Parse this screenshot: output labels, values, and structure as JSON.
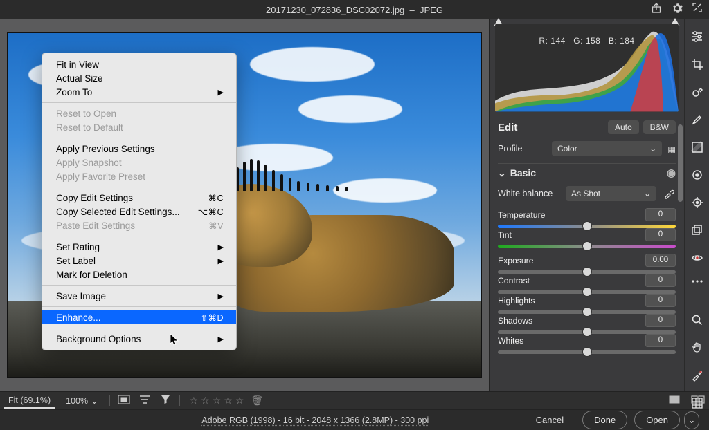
{
  "title": {
    "filename": "20171230_072836_DSC02072.jpg",
    "format": "JPEG"
  },
  "titlebar_icons": [
    "share-icon",
    "settings-icon",
    "fullscreen-icon"
  ],
  "context_menu": {
    "groups": [
      [
        {
          "label": "Fit in View",
          "arrow": false,
          "disabled": false
        },
        {
          "label": "Actual Size",
          "arrow": false,
          "disabled": false
        },
        {
          "label": "Zoom To",
          "arrow": true,
          "disabled": false
        }
      ],
      [
        {
          "label": "Reset to Open",
          "arrow": false,
          "disabled": true
        },
        {
          "label": "Reset to Default",
          "arrow": false,
          "disabled": true
        }
      ],
      [
        {
          "label": "Apply Previous Settings",
          "arrow": false,
          "disabled": false
        },
        {
          "label": "Apply Snapshot",
          "arrow": false,
          "disabled": true
        },
        {
          "label": "Apply Favorite Preset",
          "arrow": false,
          "disabled": true
        }
      ],
      [
        {
          "label": "Copy Edit Settings",
          "arrow": false,
          "shortcut": "⌘C",
          "disabled": false
        },
        {
          "label": "Copy Selected Edit Settings...",
          "arrow": false,
          "shortcut": "⌥⌘C",
          "disabled": false
        },
        {
          "label": "Paste Edit Settings",
          "arrow": false,
          "shortcut": "⌘V",
          "disabled": true
        }
      ],
      [
        {
          "label": "Set Rating",
          "arrow": true,
          "disabled": false
        },
        {
          "label": "Set Label",
          "arrow": true,
          "disabled": false
        },
        {
          "label": "Mark for Deletion",
          "arrow": false,
          "disabled": false
        }
      ],
      [
        {
          "label": "Save Image",
          "arrow": true,
          "disabled": false
        }
      ],
      [
        {
          "label": "Enhance...",
          "arrow": false,
          "shortcut_hl": "⇧⌘D",
          "highlight": true
        }
      ],
      [
        {
          "label": "Background Options",
          "arrow": true,
          "disabled": false
        }
      ]
    ]
  },
  "histogram": {
    "readout": {
      "R": 144,
      "G": 158,
      "B": 184
    }
  },
  "edit": {
    "title": "Edit",
    "buttons": {
      "auto": "Auto",
      "bw": "B&W"
    },
    "profile_label": "Profile",
    "profile_value": "Color",
    "basic_title": "Basic",
    "wb_label": "White balance",
    "wb_value": "As Shot",
    "sliders": [
      {
        "name": "Temperature",
        "value": "0",
        "variant": "temp",
        "pos": 50
      },
      {
        "name": "Tint",
        "value": "0",
        "variant": "tint",
        "pos": 50
      },
      null,
      {
        "name": "Exposure",
        "value": "0.00",
        "variant": "plain",
        "pos": 50
      },
      {
        "name": "Contrast",
        "value": "0",
        "variant": "plain",
        "pos": 50
      },
      {
        "name": "Highlights",
        "value": "0",
        "variant": "plain",
        "pos": 50
      },
      {
        "name": "Shadows",
        "value": "0",
        "variant": "plain",
        "pos": 50
      },
      {
        "name": "Whites",
        "value": "0",
        "variant": "plain",
        "pos": 50
      }
    ]
  },
  "rail_tools": [
    "sliders-icon",
    "crop-icon",
    "healing-brush-icon",
    "adjust-brush-icon",
    "gradient-icon",
    "radial-icon",
    "target-icon",
    "presets-icon",
    "red-eye-icon",
    "more-icon"
  ],
  "rail_lower": [
    "zoom-icon",
    "hand-icon",
    "pixel-icon",
    "grid-icon"
  ],
  "bottom": {
    "fit_label": "Fit (69.1%)",
    "zoom_pct": "100%",
    "before_after_icon": "before-after-icon",
    "compare_icon": "compare-icon"
  },
  "footer": {
    "meta": "Adobe RGB (1998) - 16 bit - 2048 x 1366 (2.8MP) - 300 ppi",
    "cancel": "Cancel",
    "done": "Done",
    "open": "Open"
  }
}
